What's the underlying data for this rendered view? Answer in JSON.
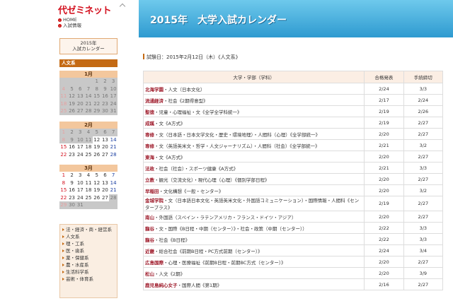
{
  "brand": {
    "logo": "代ゼミネット"
  },
  "links": [
    {
      "label": "HOME"
    },
    {
      "label": "入試情報"
    }
  ],
  "calendar_box": {
    "line1": "2015年",
    "line2": "入試カレンダー"
  },
  "cal_head": "人文系",
  "months": [
    {
      "name": "1月",
      "weeks": [
        [
          "",
          "",
          "",
          "",
          "1",
          "2",
          "3"
        ],
        [
          "4",
          "5",
          "6",
          "7",
          "8",
          "9",
          "10"
        ],
        [
          "11",
          "12",
          "13",
          "14",
          "15",
          "16",
          "17"
        ],
        [
          "18",
          "19",
          "20",
          "21",
          "22",
          "23",
          "24"
        ],
        [
          "25",
          "26",
          "27",
          "28",
          "29",
          "30",
          "31"
        ]
      ]
    },
    {
      "name": "2月",
      "weeks": [
        [
          "1",
          "2",
          "3",
          "4",
          "5",
          "6",
          "7"
        ],
        [
          "8",
          "9",
          "10",
          "11",
          "12",
          "13",
          "14"
        ],
        [
          "15",
          "16",
          "17",
          "18",
          "19",
          "20",
          "21"
        ],
        [
          "22",
          "23",
          "24",
          "25",
          "26",
          "27",
          "28"
        ]
      ]
    },
    {
      "name": "3月",
      "weeks": [
        [
          "1",
          "2",
          "3",
          "4",
          "5",
          "6",
          "7"
        ],
        [
          "8",
          "9",
          "10",
          "11",
          "12",
          "13",
          "14"
        ],
        [
          "15",
          "16",
          "17",
          "18",
          "19",
          "20",
          "21"
        ],
        [
          "22",
          "23",
          "24",
          "25",
          "26",
          "27",
          "28"
        ],
        [
          "29",
          "30",
          "31",
          "",
          "",
          "",
          ""
        ]
      ]
    }
  ],
  "categories": [
    "法・経済・商・経営系",
    "人文系",
    "理・工系",
    "医・歯系",
    "薬・保健系",
    "農・水産系",
    "生活科学系",
    "芸術・体育系"
  ],
  "banner": {
    "title": "2015年　大学入試カレンダー"
  },
  "date_line": "試験日：2015年2月12日（木）《人文系》",
  "table": {
    "headers": [
      "大学・学部（学科）",
      "合格発表",
      "手続締切"
    ],
    "rows": [
      {
        "univ": "北海学園",
        "dept": "・人文（日本文化）",
        "result": "2/24",
        "deadline": "3/3"
      },
      {
        "univ": "流通経済",
        "dept": "・社会《2期得意型》",
        "result": "2/17",
        "deadline": "2/24"
      },
      {
        "univ": "聖徳",
        "dept": "・児童・心理福祉・文《全学全学科統一》",
        "result": "2/19",
        "deadline": "2/26"
      },
      {
        "univ": "成蹊",
        "dept": "・文《A方式》",
        "result": "2/19",
        "deadline": "2/27"
      },
      {
        "univ": "専修",
        "dept": "・文（日本語・日本文学文化・歴史・環境地理）・人間科（心理）《全学部統一》",
        "result": "2/20",
        "deadline": "2/27"
      },
      {
        "univ": "専修",
        "dept": "・文（英語英米文・哲学・人文ジャーナリズム）・人間科（社会）《全学部統一》",
        "result": "2/21",
        "deadline": "3/2"
      },
      {
        "univ": "東海",
        "dept": "・文《A方式》",
        "result": "2/20",
        "deadline": "2/27"
      },
      {
        "univ": "法政",
        "dept": "・社会（社会）・スポーツ健康《A方式》",
        "result": "2/21",
        "deadline": "3/3"
      },
      {
        "univ": "立教",
        "dept": "・観光（交流文化）・現代心理（心理）《個別学部日程》",
        "result": "2/20",
        "deadline": "2/27"
      },
      {
        "univ": "早稲田",
        "dept": "・文化構想《一般・センター》",
        "result": "2/20",
        "deadline": "3/2"
      },
      {
        "univ": "金城学院",
        "dept": "・文（日本語日本文化・英語英米文化・外国語コミュニケーション）・国際情報・人間科《センタープラス》",
        "result": "2/19",
        "deadline": "2/27"
      },
      {
        "univ": "南山",
        "dept": "・外国語（スペイン・ラテンアメリカ・フランス・ドイツ・アジア）",
        "result": "2/20",
        "deadline": "2/27"
      },
      {
        "univ": "龍谷",
        "dept": "・文・国際《B日程・中期（センター）》・社会・政策（中期（センター））",
        "result": "2/22",
        "deadline": "3/3"
      },
      {
        "univ": "龍谷",
        "dept": "・社会《B日程》",
        "result": "2/22",
        "deadline": "3/3"
      },
      {
        "univ": "近畿",
        "dept": "・総合社会《前期B日程・PC方式前期（センター）》",
        "result": "2/24",
        "deadline": "3/4"
      },
      {
        "univ": "広島国際",
        "dept": "・心理・医療福祉《前期B日程・前期BC方式（センター）》",
        "result": "2/20",
        "deadline": "2/27"
      },
      {
        "univ": "松山",
        "dept": "・人文《2期》",
        "result": "2/20",
        "deadline": "3/9"
      },
      {
        "univ": "鹿児島純心女子",
        "dept": "・国際人間《第1期》",
        "result": "2/16",
        "deadline": "2/27"
      }
    ]
  }
}
